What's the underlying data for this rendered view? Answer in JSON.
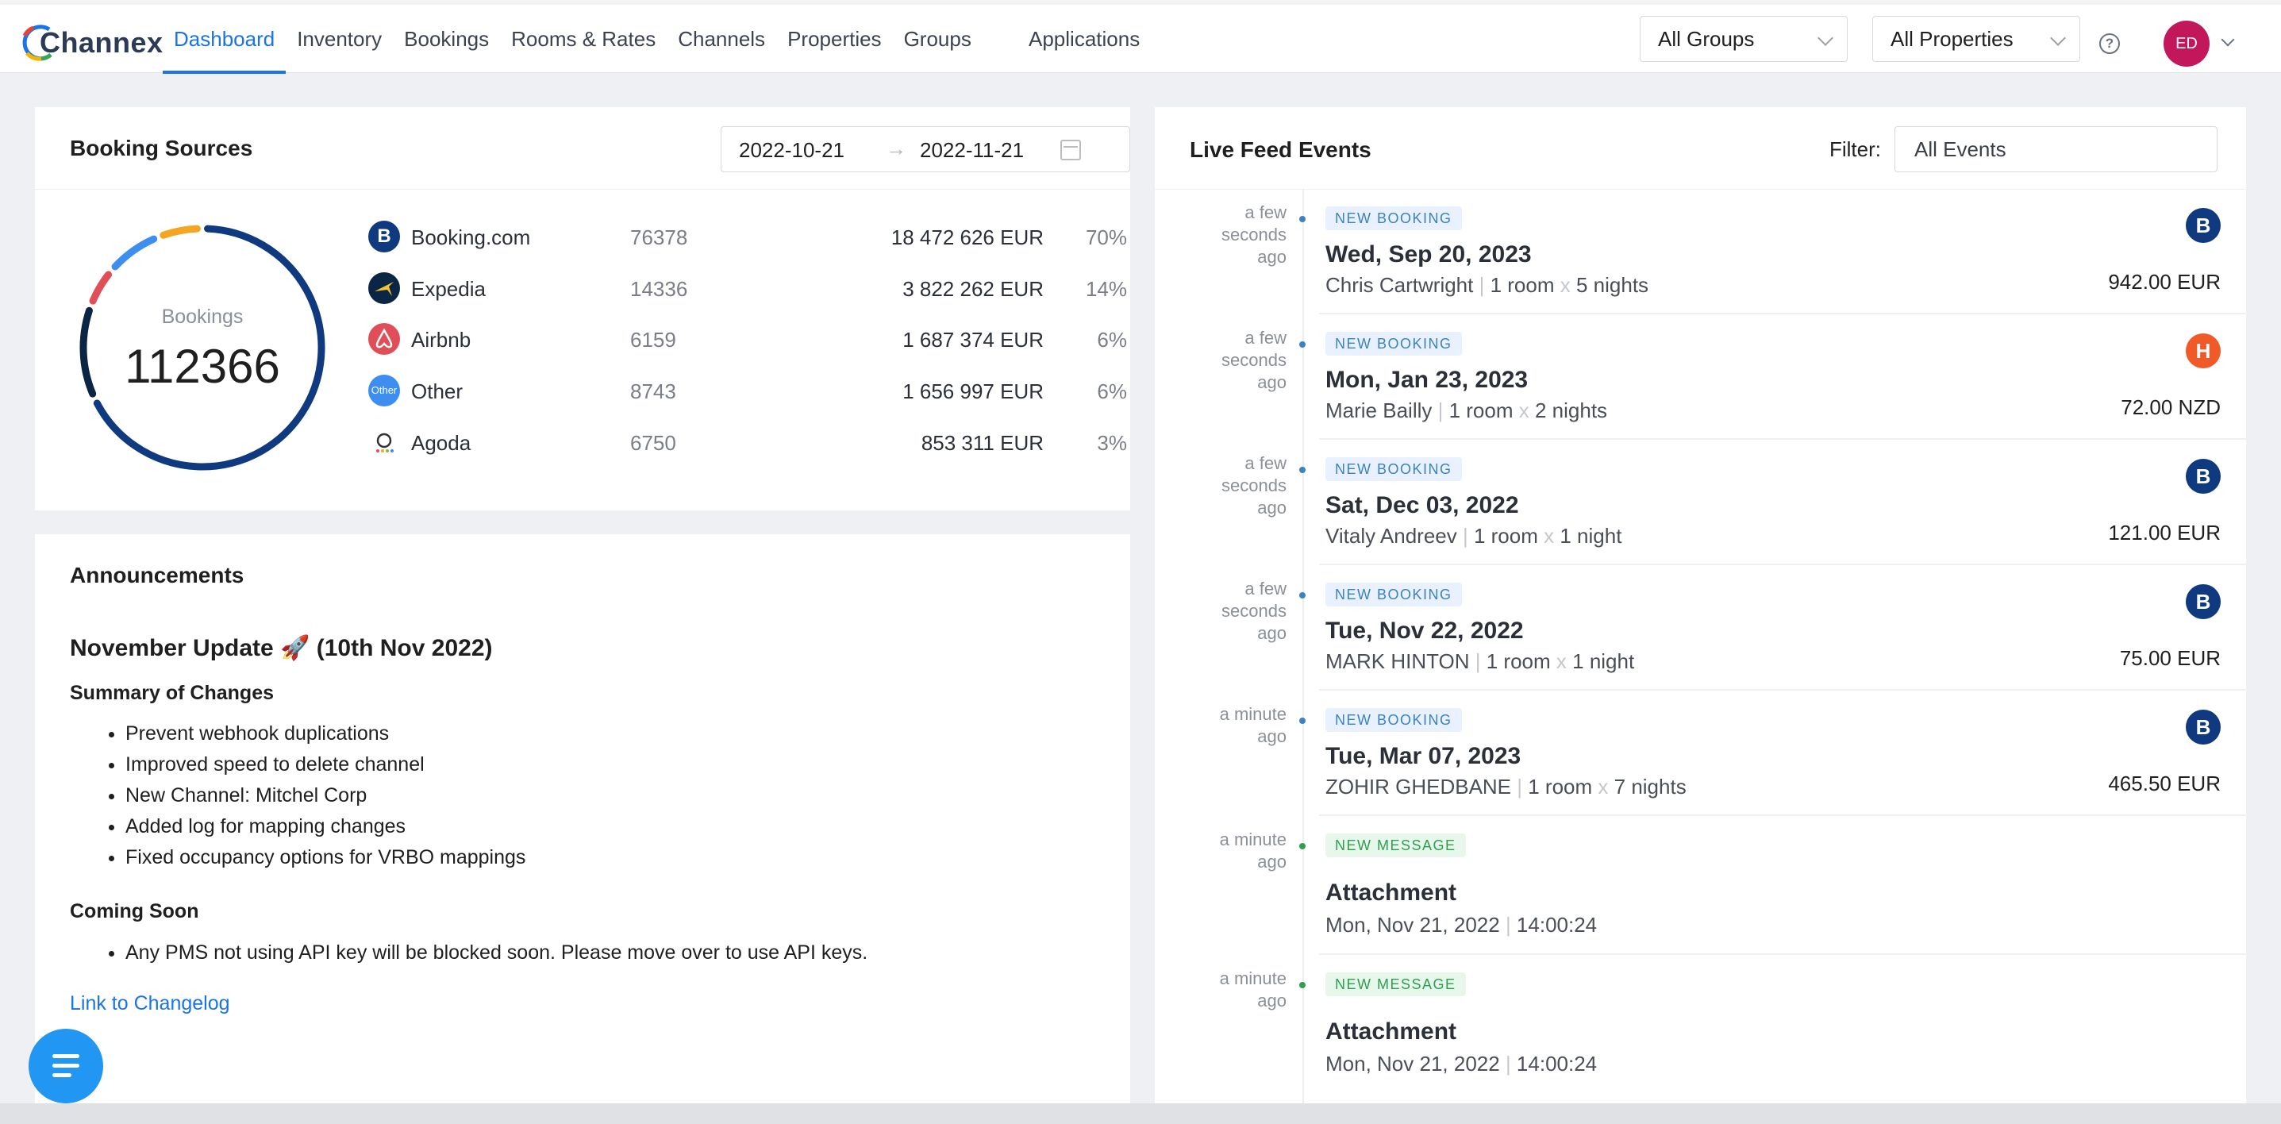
{
  "brand": {
    "name": "Channex"
  },
  "nav": {
    "items": [
      {
        "label": "Dashboard",
        "active": true
      },
      {
        "label": "Inventory"
      },
      {
        "label": "Bookings"
      },
      {
        "label": "Rooms & Rates"
      },
      {
        "label": "Channels"
      },
      {
        "label": "Properties"
      },
      {
        "label": "Groups"
      }
    ],
    "applications": "Applications",
    "groups_select": "All Groups",
    "properties_select": "All Properties",
    "user_initials": "ED"
  },
  "booking_sources": {
    "title": "Booking Sources",
    "date_from": "2022-10-21",
    "date_to": "2022-11-21",
    "total_label": "Bookings",
    "total_value": "112366",
    "sources": [
      {
        "name": "Booking.com",
        "count": "76378",
        "revenue": "18 472 626 EUR",
        "pct": "70%",
        "icon": "booking-com-icon",
        "color": "#0f3a80"
      },
      {
        "name": "Expedia",
        "count": "14336",
        "revenue": "3 822 262 EUR",
        "pct": "14%",
        "icon": "expedia-icon",
        "color": "#0b2545"
      },
      {
        "name": "Airbnb",
        "count": "6159",
        "revenue": "1 687 374 EUR",
        "pct": "6%",
        "icon": "airbnb-icon",
        "color": "#e04e57"
      },
      {
        "name": "Other",
        "count": "8743",
        "revenue": "1 656 997 EUR",
        "pct": "6%",
        "icon": "other-icon",
        "color": "#3d8ef0"
      },
      {
        "name": "Agoda",
        "count": "6750",
        "revenue": "853 311 EUR",
        "pct": "3%",
        "icon": "agoda-icon",
        "color": "#f4a623"
      }
    ]
  },
  "announcements": {
    "title": "Announcements",
    "update_title": "November Update 🚀 (10th Nov 2022)",
    "summary_heading": "Summary of Changes",
    "changes": [
      "Prevent webhook duplications",
      "Improved speed to delete channel",
      "New Channel: Mitchel Corp",
      "Added log for mapping changes",
      "Fixed occupancy options for VRBO mappings"
    ],
    "coming_heading": "Coming Soon",
    "coming": [
      "Any PMS not using API key will be blocked soon. Please move over to use API keys."
    ],
    "link": "Link to Changelog"
  },
  "feed": {
    "title": "Live Feed Events",
    "filter_label": "Filter:",
    "filter_value": "All Events",
    "events": [
      {
        "time": "a few seconds ago",
        "tag": "NEW BOOKING",
        "kind": "booking",
        "title": "Wed, Sep 20, 2023",
        "guest": "Chris Cartwright",
        "rooms": "1 room",
        "nights": "5 nights",
        "amount": "942.00 EUR",
        "channel_icon": "booking-com-icon",
        "channel_letter": "B",
        "channel_color": "#0f3a80"
      },
      {
        "time": "a few seconds ago",
        "tag": "NEW BOOKING",
        "kind": "booking",
        "title": "Mon, Jan 23, 2023",
        "guest": "Marie Bailly",
        "rooms": "1 room",
        "nights": "2 nights",
        "amount": "72.00 NZD",
        "channel_icon": "hotels-com-icon",
        "channel_letter": "H",
        "channel_color": "#f05a28"
      },
      {
        "time": "a few seconds ago",
        "tag": "NEW BOOKING",
        "kind": "booking",
        "title": "Sat, Dec 03, 2022",
        "guest": "Vitaly Andreev",
        "rooms": "1 room",
        "nights": "1 night",
        "amount": "121.00 EUR",
        "channel_icon": "booking-com-icon",
        "channel_letter": "B",
        "channel_color": "#0f3a80"
      },
      {
        "time": "a few seconds ago",
        "tag": "NEW BOOKING",
        "kind": "booking",
        "title": "Tue, Nov 22, 2022",
        "guest": "MARK HINTON",
        "rooms": "1 room",
        "nights": "1 night",
        "amount": "75.00 EUR",
        "channel_icon": "booking-com-icon",
        "channel_letter": "B",
        "channel_color": "#0f3a80"
      },
      {
        "time": "a minute ago",
        "tag": "NEW BOOKING",
        "kind": "booking",
        "title": "Tue, Mar 07, 2023",
        "guest": "ZOHIR GHEDBANE",
        "rooms": "1 room",
        "nights": "7 nights",
        "amount": "465.50 EUR",
        "channel_icon": "booking-com-icon",
        "channel_letter": "B",
        "channel_color": "#0f3a80"
      },
      {
        "time": "a minute ago",
        "tag": "NEW MESSAGE",
        "kind": "message",
        "title": "Attachment",
        "date": "Mon, Nov 21, 2022",
        "clock": "14:00:24"
      },
      {
        "time": "a minute ago",
        "tag": "NEW MESSAGE",
        "kind": "message",
        "title": "Attachment",
        "date": "Mon, Nov 21, 2022",
        "clock": "14:00:24"
      }
    ]
  },
  "colors": {
    "accent": "#1a73e8",
    "booking_tag": "#3b82c4",
    "message_tag": "#2e9e4f"
  }
}
